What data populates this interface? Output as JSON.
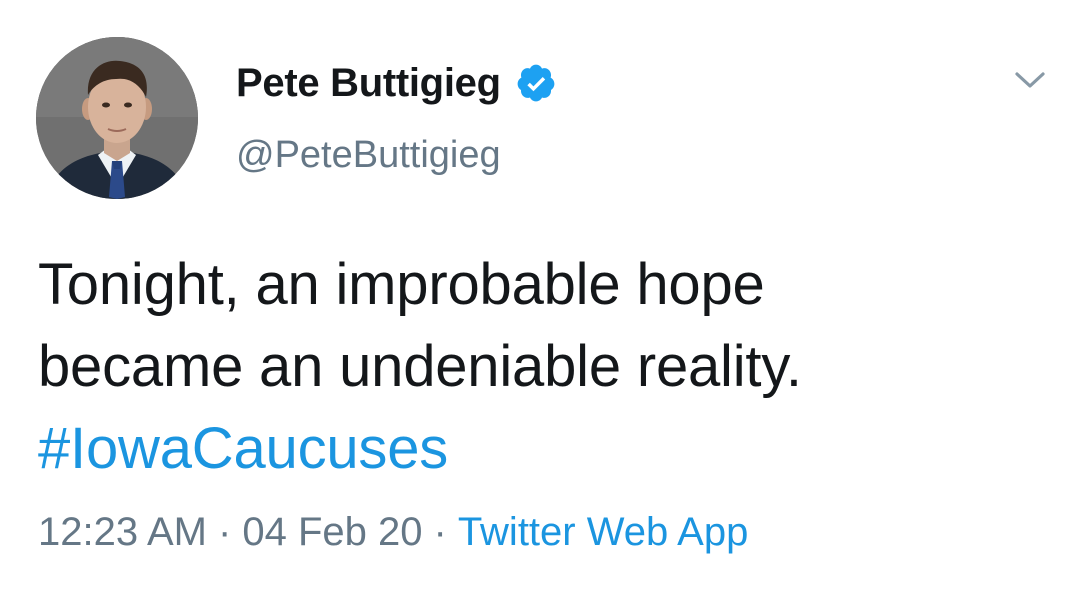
{
  "tweet": {
    "display_name": "Pete Buttigieg",
    "handle": "@PeteButtigieg",
    "text_line_1": "Tonight, an improbable hope",
    "text_line_2": "became an undeniable reality.",
    "hashtag": "#IowaCaucuses",
    "time": "12:23 AM",
    "separator_1": "·",
    "date": "04 Feb 20",
    "separator_2": "·",
    "source": "Twitter Web App"
  },
  "icons": {
    "verified": "verified-badge-icon",
    "menu": "chevron-down-icon"
  },
  "colors": {
    "text": "#14171a",
    "secondary": "#657786",
    "link": "#1b95e0",
    "verified": "#1da1f2",
    "background": "#ffffff"
  }
}
